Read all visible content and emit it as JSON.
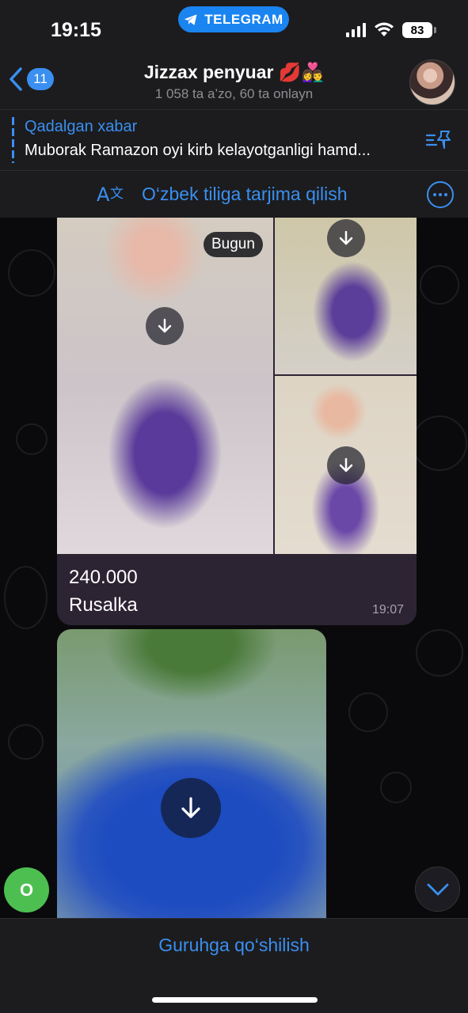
{
  "status_bar": {
    "time": "19:15",
    "app_pill": "TELEGRAM",
    "battery": "83"
  },
  "header": {
    "back_count": "11",
    "title": "Jizzax penyuar 💋👩‍❤️‍👨",
    "subtitle": "1 058 ta a’zo, 60 ta onlayn"
  },
  "pinned": {
    "title": "Qadalgan xabar",
    "text": "Muborak Ramazon oyi kirb kelayotganligi hamd..."
  },
  "translate_bar": {
    "label": "O‘zbek tiliga tarjima qilish"
  },
  "album": {
    "date_pill": "Bugun",
    "caption_line1": "240.000",
    "caption_line2": "Rusalka",
    "time": "19:07"
  },
  "sender_avatar": {
    "initial": "O"
  },
  "bottom_bar": {
    "join_label": "Guruhga qo‘shilish"
  },
  "colors": {
    "accent": "#3a8ff0",
    "bubble": "#2d2433",
    "bar": "#1c1c1e",
    "avatar_green": "#4cbf50"
  }
}
